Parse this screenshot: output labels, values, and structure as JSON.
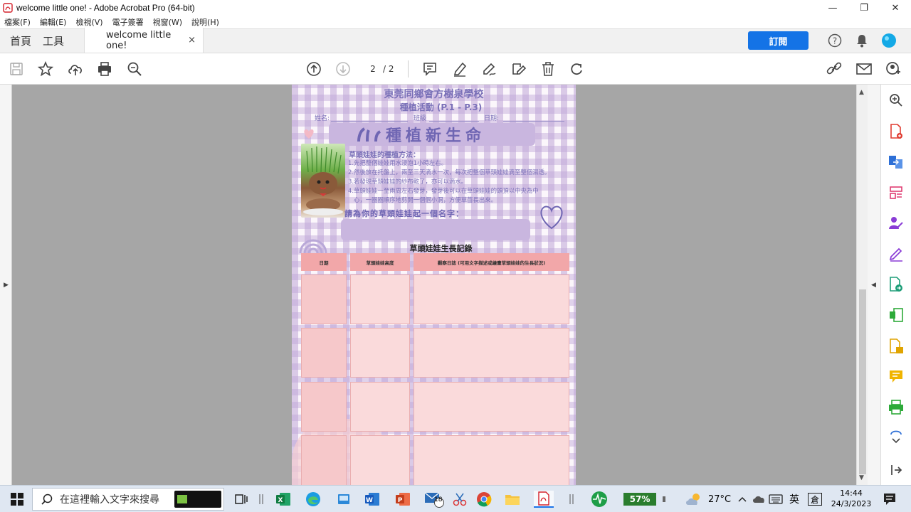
{
  "window": {
    "title": "welcome little one! - Adobe Acrobat Pro (64-bit)",
    "minimize": "—",
    "restore": "❐",
    "close": "✕"
  },
  "menu": [
    "檔案(F)",
    "編輯(E)",
    "檢視(V)",
    "電子簽署",
    "視窗(W)",
    "說明(H)"
  ],
  "tabs": {
    "home": "首頁",
    "tools": "工具",
    "document": "welcome little one!",
    "doc_close": "×",
    "subscribe": "訂閱"
  },
  "toolbar": {
    "current_page": "2",
    "total_pages": "/ 2"
  },
  "pdf": {
    "school": "東莞同鄉會方樹泉學校",
    "activity": "種植活動 (P.1 - P.3)",
    "field_name": "姓名:",
    "field_class": "班級",
    "field_date": "日期:",
    "banner": "種植新生命",
    "method_title": "草頭娃娃的種植方法：",
    "steps": [
      "1.先把整個娃娃用水浸泡1小時左右。",
      "2.然後放在托盤上，兩至三天滴水一次，每次把整個草頭娃娃滴至整個濕透。",
      "3.若發現草頭娃娃的紗布乾了，亦可以滴水。",
      "4.草頭娃娃一至兩周左右發芽，發芽後可以在草頭娃娃的頭頂以中央為中",
      "   心，一圈圈順序地剪開一個個小洞，方便草苗長出來。"
    ],
    "name_prompt": "請為你的草頭娃娃起一個名字：",
    "growth_title": "草頭娃娃生長記錄",
    "col_date": "日期",
    "col_height": "草頭娃娃高度",
    "col_diary": "觀察日誌 (可用文字描述或繪畫草頭娃娃的生長狀況)"
  },
  "taskbar": {
    "search_placeholder": "在這裡輸入文字來搜尋",
    "battery": "57%",
    "weather": "27°C",
    "ime_lang": "英",
    "ime_mode": "倉",
    "time": "14:44",
    "date": "24/3/2023",
    "mail_badge": "18"
  },
  "colors": {
    "accent": "#1473e6",
    "pdf_purple": "#7a70b8",
    "table_header": "#f2a7a9",
    "table_cell": "#fadadb"
  }
}
